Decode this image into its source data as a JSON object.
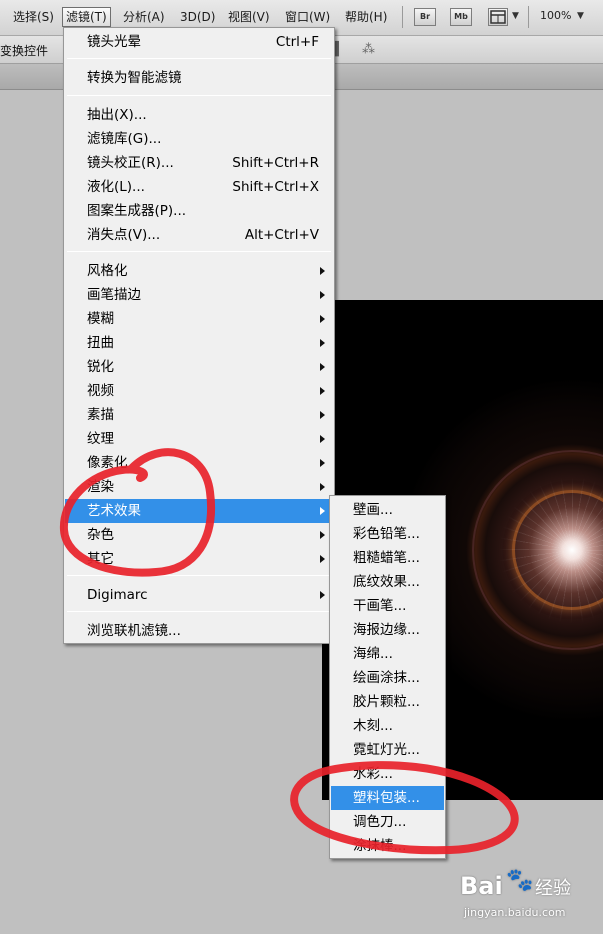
{
  "menubar": {
    "items": [
      "选择(S)",
      "滤镜(T)",
      "分析(A)",
      "3D(D)",
      "视图(V)",
      "窗口(W)",
      "帮助(H)"
    ],
    "active_index": 1,
    "bridge_label": "Br",
    "minibridge_label": "Mb",
    "zoom": "100%"
  },
  "options_bar": {
    "label": "变换控件"
  },
  "filter_menu": {
    "items": [
      {
        "label": "镜头光晕",
        "shortcut": "Ctrl+F"
      },
      {
        "label": "转换为智能滤镜"
      },
      {
        "label": "抽出(X)..."
      },
      {
        "label": "滤镜库(G)..."
      },
      {
        "label": "镜头校正(R)...",
        "shortcut": "Shift+Ctrl+R"
      },
      {
        "label": "液化(L)...",
        "shortcut": "Shift+Ctrl+X"
      },
      {
        "label": "图案生成器(P)..."
      },
      {
        "label": "消失点(V)...",
        "shortcut": "Alt+Ctrl+V"
      },
      {
        "label": "风格化",
        "submenu": true
      },
      {
        "label": "画笔描边",
        "submenu": true
      },
      {
        "label": "模糊",
        "submenu": true
      },
      {
        "label": "扭曲",
        "submenu": true
      },
      {
        "label": "锐化",
        "submenu": true
      },
      {
        "label": "视频",
        "submenu": true
      },
      {
        "label": "素描",
        "submenu": true
      },
      {
        "label": "纹理",
        "submenu": true
      },
      {
        "label": "像素化",
        "submenu": true
      },
      {
        "label": "渲染",
        "submenu": true
      },
      {
        "label": "艺术效果",
        "submenu": true,
        "highlighted": true
      },
      {
        "label": "杂色",
        "submenu": true
      },
      {
        "label": "其它",
        "submenu": true
      },
      {
        "label": "Digimarc",
        "submenu": true
      },
      {
        "label": "浏览联机滤镜..."
      }
    ]
  },
  "artistic_submenu": {
    "items": [
      {
        "label": "壁画..."
      },
      {
        "label": "彩色铅笔..."
      },
      {
        "label": "粗糙蜡笔..."
      },
      {
        "label": "底纹效果..."
      },
      {
        "label": "干画笔..."
      },
      {
        "label": "海报边缘..."
      },
      {
        "label": "海绵..."
      },
      {
        "label": "绘画涂抹..."
      },
      {
        "label": "胶片颗粒..."
      },
      {
        "label": "木刻..."
      },
      {
        "label": "霓虹灯光..."
      },
      {
        "label": "水彩..."
      },
      {
        "label": "塑料包装...",
        "highlighted": true
      },
      {
        "label": "调色刀..."
      },
      {
        "label": "涂抹棒..."
      }
    ]
  },
  "watermark": {
    "logo": "Bai",
    "paw": "🐾",
    "product": "经验",
    "url": "jingyan.baidu.com"
  },
  "colors": {
    "highlight": "#3390e8",
    "annotation": "#e8222a"
  }
}
